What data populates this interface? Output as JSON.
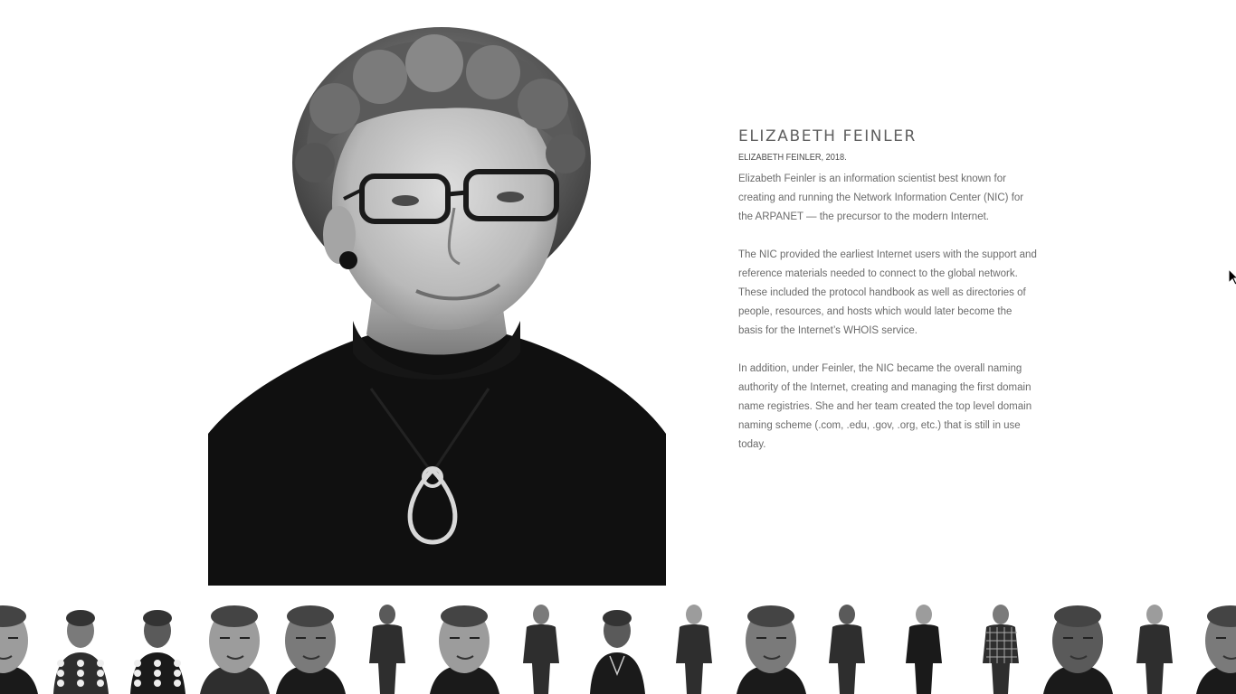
{
  "profile": {
    "name": "ELIZABETH FEINLER",
    "caption": "ELIZABETH FEINLER, 2018.",
    "paragraphs": [
      "Elizabeth Feinler is an information scientist best known for creating and running the Network Information Center (NIC) for the ARPANET — the precursor to the modern Internet.",
      "The NIC provided the earliest Internet users with the support and reference materials needed to connect to the global network. These included the protocol handbook as well as directories of people, resources, and hosts which would later become the basis for the Internet’s WHOIS service.",
      "In addition, under Feinler, the NIC became the overall naming authority of the Internet, creating and managing the first domain name registries. She and her team created the top level domain naming scheme (.com, .edu, .gov, .org, etc.) that is still in use today."
    ]
  },
  "colors": {
    "background": "#ffffff",
    "text": "#6b6b6b",
    "heading": "#5f5f5f",
    "photo_dark": "#111111"
  },
  "thumbnails": [
    {
      "icon": "portrait-man-gray-beard",
      "style": "closeup"
    },
    {
      "icon": "portrait-woman-dotted-blouse",
      "style": "halfbody"
    },
    {
      "icon": "portrait-woman-polka-dot",
      "style": "halfbody"
    },
    {
      "icon": "portrait-man-bald-glasses",
      "style": "closeup"
    },
    {
      "icon": "portrait-woman-dark-hair-glasses",
      "style": "closeup"
    },
    {
      "icon": "portrait-man-athletic",
      "style": "fullbody"
    },
    {
      "icon": "portrait-man-bald",
      "style": "closeup"
    },
    {
      "icon": "portrait-elderly-woman-vest",
      "style": "fullbody"
    },
    {
      "icon": "portrait-elderly-woman-pendant",
      "style": "halfbody"
    },
    {
      "icon": "portrait-man-tshirt",
      "style": "fullbody"
    },
    {
      "icon": "portrait-man-gray-hair",
      "style": "closeup"
    },
    {
      "icon": "portrait-woman-black-dress",
      "style": "fullbody"
    },
    {
      "icon": "portrait-woman-crossed-arms",
      "style": "fullbody"
    },
    {
      "icon": "portrait-man-plaid-shirt",
      "style": "fullbody"
    },
    {
      "icon": "portrait-man-black-hair",
      "style": "closeup"
    },
    {
      "icon": "portrait-man-dark-shirt",
      "style": "fullbody"
    },
    {
      "icon": "portrait-man-bald-gray",
      "style": "closeup"
    }
  ]
}
